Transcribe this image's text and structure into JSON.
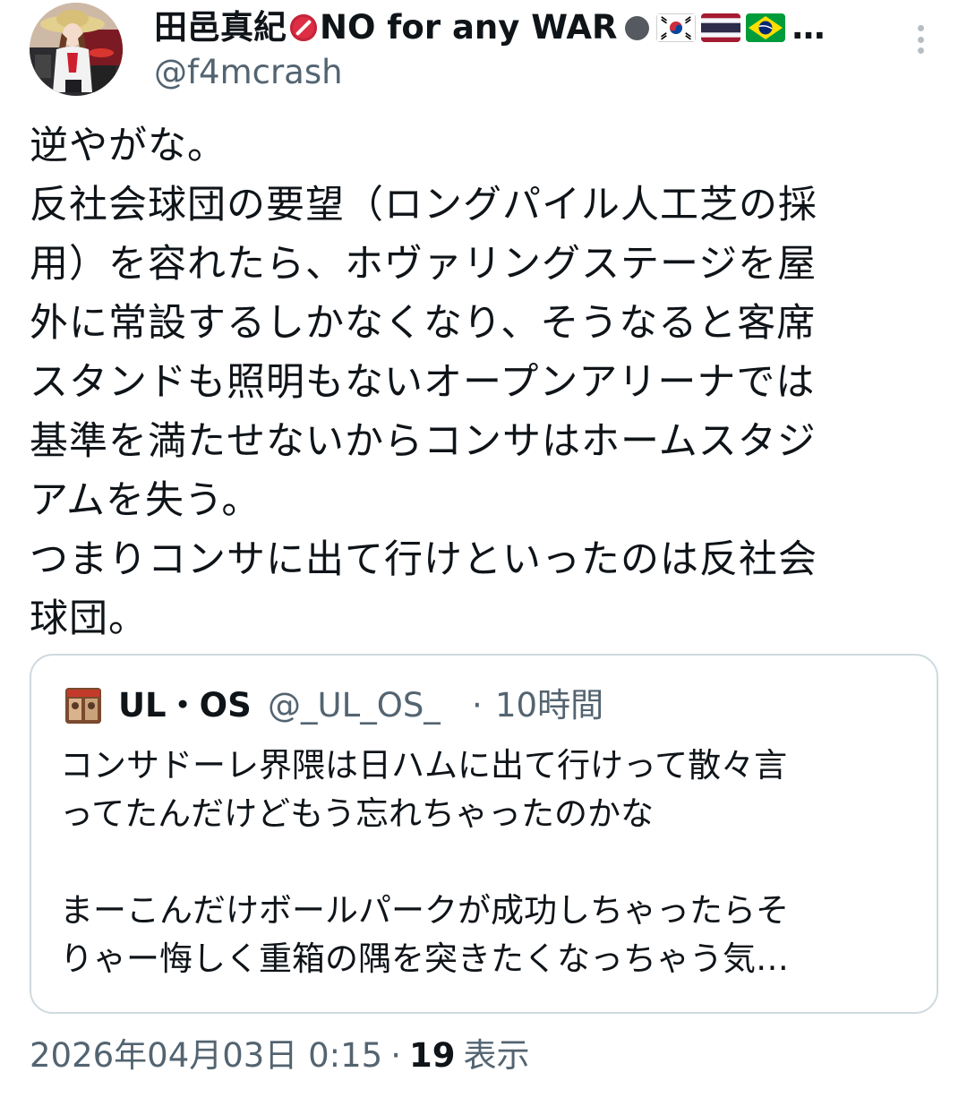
{
  "author": {
    "display_name_start": "田邑真紀",
    "display_name_rest": "NO for any WAR",
    "display_name_tail": "…",
    "status_emojis": [
      "no-entry-sign-red",
      "black-circle"
    ],
    "flags": [
      "south-korea",
      "thailand",
      "brazil"
    ],
    "handle": "@f4mcrash"
  },
  "tweet": {
    "lines": [
      "逆やがな。",
      "反社会球団の要望（ロングパイル人工芝の採",
      "用）を容れたら、ホヴァリングステージを屋",
      "外に常設するしかなくなり、そうなると客席",
      "スタンドも照明もないオープンアリーナでは",
      "基準を満たせないからコンサはホームスタジ",
      "アムを失う。",
      "つまりコンサに出て行けといったのは反社会",
      "球団。"
    ]
  },
  "quote": {
    "name": "UL・OS",
    "handle": "@_UL_OS_",
    "separator": "·",
    "time": "10時間",
    "paragraph1": [
      "コンサドーレ界隈は日ハムに出て行けって散々言",
      "ってたんだけどもう忘れちゃったのかな"
    ],
    "paragraph2": [
      "まーこんだけボールパークが成功しちゃったらそ",
      "りゃー悔しく重箱の隅を突きたくなっちゃう気…"
    ]
  },
  "meta": {
    "timestamp": "2026年04月03日 0:15",
    "separator": "·",
    "views_count": "19",
    "views_label": "表示"
  },
  "colors": {
    "text": "#0f1419",
    "secondary": "#536471",
    "border": "#cfd9de",
    "red_dot": "#dd2e44"
  }
}
